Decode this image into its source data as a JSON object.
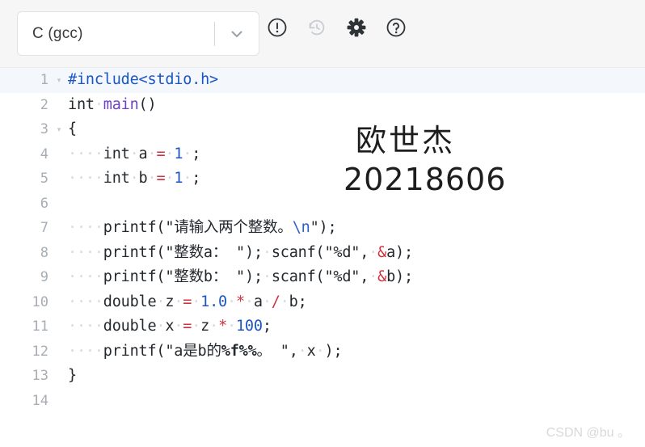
{
  "toolbar": {
    "language_select": {
      "value": "C (gcc)",
      "caret_icon": "chevron-down-icon"
    },
    "icons": [
      {
        "name": "exclamation-circle-icon",
        "label": "Report issue",
        "color": "#2f3437",
        "disabled": false
      },
      {
        "name": "history-icon",
        "label": "Revision history",
        "color": "#c9cdd1",
        "disabled": true
      },
      {
        "name": "gear-icon",
        "label": "Settings",
        "color": "#2f3437",
        "disabled": false
      },
      {
        "name": "question-circle-icon",
        "label": "Help",
        "color": "#2f3437",
        "disabled": false
      }
    ]
  },
  "editor": {
    "active_line": 1,
    "lines": [
      {
        "number": "1",
        "fold": "▾",
        "active": true,
        "tokens": [
          {
            "text": "#include<stdio.h>",
            "cls": "t-pre"
          }
        ]
      },
      {
        "number": "2",
        "fold": "",
        "active": false,
        "tokens": [
          {
            "text": "int",
            "cls": "t-plain"
          },
          {
            "text": "·",
            "cls": "ws"
          },
          {
            "text": "main",
            "cls": "t-fn"
          },
          {
            "text": "()",
            "cls": "t-plain"
          }
        ]
      },
      {
        "number": "3",
        "fold": "▾",
        "active": false,
        "tokens": [
          {
            "text": "{",
            "cls": "t-plain"
          }
        ]
      },
      {
        "number": "4",
        "fold": "",
        "active": false,
        "tokens": [
          {
            "text": "····",
            "cls": "ws"
          },
          {
            "text": "int",
            "cls": "t-plain"
          },
          {
            "text": "·",
            "cls": "ws"
          },
          {
            "text": "a",
            "cls": "t-plain"
          },
          {
            "text": "·",
            "cls": "ws"
          },
          {
            "text": "=",
            "cls": "t-op"
          },
          {
            "text": "·",
            "cls": "ws"
          },
          {
            "text": "1",
            "cls": "t-num"
          },
          {
            "text": "·",
            "cls": "ws"
          },
          {
            "text": ";",
            "cls": "t-plain"
          }
        ]
      },
      {
        "number": "5",
        "fold": "",
        "active": false,
        "tokens": [
          {
            "text": "····",
            "cls": "ws"
          },
          {
            "text": "int",
            "cls": "t-plain"
          },
          {
            "text": "·",
            "cls": "ws"
          },
          {
            "text": "b",
            "cls": "t-plain"
          },
          {
            "text": "·",
            "cls": "ws"
          },
          {
            "text": "=",
            "cls": "t-op"
          },
          {
            "text": "·",
            "cls": "ws"
          },
          {
            "text": "1",
            "cls": "t-num"
          },
          {
            "text": "·",
            "cls": "ws"
          },
          {
            "text": ";",
            "cls": "t-plain"
          }
        ]
      },
      {
        "number": "6",
        "fold": "",
        "active": false,
        "tokens": []
      },
      {
        "number": "7",
        "fold": "",
        "active": false,
        "tokens": [
          {
            "text": "····",
            "cls": "ws"
          },
          {
            "text": "printf(",
            "cls": "t-plain"
          },
          {
            "text": "\"请输入两个整数。",
            "cls": "t-str"
          },
          {
            "text": "\\n",
            "cls": "t-esc"
          },
          {
            "text": "\"",
            "cls": "t-str"
          },
          {
            "text": ");",
            "cls": "t-plain"
          }
        ]
      },
      {
        "number": "8",
        "fold": "",
        "active": false,
        "tokens": [
          {
            "text": "····",
            "cls": "ws"
          },
          {
            "text": "printf(",
            "cls": "t-plain"
          },
          {
            "text": "\"整数a： \"",
            "cls": "t-str"
          },
          {
            "text": ");",
            "cls": "t-plain"
          },
          {
            "text": "·",
            "cls": "ws"
          },
          {
            "text": "scanf(",
            "cls": "t-plain"
          },
          {
            "text": "\"%d\"",
            "cls": "t-str"
          },
          {
            "text": ",",
            "cls": "t-plain"
          },
          {
            "text": "·",
            "cls": "ws"
          },
          {
            "text": "&",
            "cls": "t-op"
          },
          {
            "text": "a);",
            "cls": "t-plain"
          }
        ]
      },
      {
        "number": "9",
        "fold": "",
        "active": false,
        "tokens": [
          {
            "text": "····",
            "cls": "ws"
          },
          {
            "text": "printf(",
            "cls": "t-plain"
          },
          {
            "text": "\"整数b： \"",
            "cls": "t-str"
          },
          {
            "text": ");",
            "cls": "t-plain"
          },
          {
            "text": "·",
            "cls": "ws"
          },
          {
            "text": "scanf(",
            "cls": "t-plain"
          },
          {
            "text": "\"%d\"",
            "cls": "t-str"
          },
          {
            "text": ",",
            "cls": "t-plain"
          },
          {
            "text": "·",
            "cls": "ws"
          },
          {
            "text": "&",
            "cls": "t-op"
          },
          {
            "text": "b);",
            "cls": "t-plain"
          }
        ]
      },
      {
        "number": "10",
        "fold": "",
        "active": false,
        "tokens": [
          {
            "text": "····",
            "cls": "ws"
          },
          {
            "text": "double",
            "cls": "t-plain"
          },
          {
            "text": "·",
            "cls": "ws"
          },
          {
            "text": "z",
            "cls": "t-plain"
          },
          {
            "text": "·",
            "cls": "ws"
          },
          {
            "text": "=",
            "cls": "t-op"
          },
          {
            "text": "·",
            "cls": "ws"
          },
          {
            "text": "1.0",
            "cls": "t-num"
          },
          {
            "text": "·",
            "cls": "ws"
          },
          {
            "text": "*",
            "cls": "t-op"
          },
          {
            "text": "·",
            "cls": "ws"
          },
          {
            "text": "a",
            "cls": "t-plain"
          },
          {
            "text": "·",
            "cls": "ws"
          },
          {
            "text": "/",
            "cls": "t-op"
          },
          {
            "text": "·",
            "cls": "ws"
          },
          {
            "text": "b;",
            "cls": "t-plain"
          }
        ]
      },
      {
        "number": "11",
        "fold": "",
        "active": false,
        "tokens": [
          {
            "text": "····",
            "cls": "ws"
          },
          {
            "text": "double",
            "cls": "t-plain"
          },
          {
            "text": "·",
            "cls": "ws"
          },
          {
            "text": "x",
            "cls": "t-plain"
          },
          {
            "text": "·",
            "cls": "ws"
          },
          {
            "text": "=",
            "cls": "t-op"
          },
          {
            "text": "·",
            "cls": "ws"
          },
          {
            "text": "z",
            "cls": "t-plain"
          },
          {
            "text": "·",
            "cls": "ws"
          },
          {
            "text": "*",
            "cls": "t-op"
          },
          {
            "text": "·",
            "cls": "ws"
          },
          {
            "text": "100",
            "cls": "t-num"
          },
          {
            "text": ";",
            "cls": "t-plain"
          }
        ]
      },
      {
        "number": "12",
        "fold": "",
        "active": false,
        "tokens": [
          {
            "text": "····",
            "cls": "ws"
          },
          {
            "text": "printf(",
            "cls": "t-plain"
          },
          {
            "text": "\"a是b的",
            "cls": "t-str"
          },
          {
            "text": "%f%%",
            "cls": "t-str t-bold"
          },
          {
            "text": "。 \"",
            "cls": "t-str"
          },
          {
            "text": ",",
            "cls": "t-plain"
          },
          {
            "text": "·",
            "cls": "ws"
          },
          {
            "text": "x",
            "cls": "t-plain"
          },
          {
            "text": "·",
            "cls": "ws"
          },
          {
            "text": ");",
            "cls": "t-plain"
          }
        ]
      },
      {
        "number": "13",
        "fold": "",
        "active": false,
        "tokens": [
          {
            "text": "}",
            "cls": "t-plain"
          }
        ]
      },
      {
        "number": "14",
        "fold": "",
        "active": false,
        "tokens": []
      }
    ]
  },
  "annotation": {
    "name": "欧世杰",
    "student_id": "20218606"
  },
  "watermark": {
    "text": "CSDN @bu 。"
  },
  "colors": {
    "toolbar_bg": "#f6f6f6",
    "editor_bg": "#ffffff",
    "active_line_bg": "#f4f7fb",
    "gutter_text": "#a6adb4",
    "keyword_blue": "#1a56c4",
    "function_purple": "#6f42c1",
    "operator_red": "#d03040",
    "text_default": "#24292e",
    "watermark": "#d9d9d9"
  }
}
